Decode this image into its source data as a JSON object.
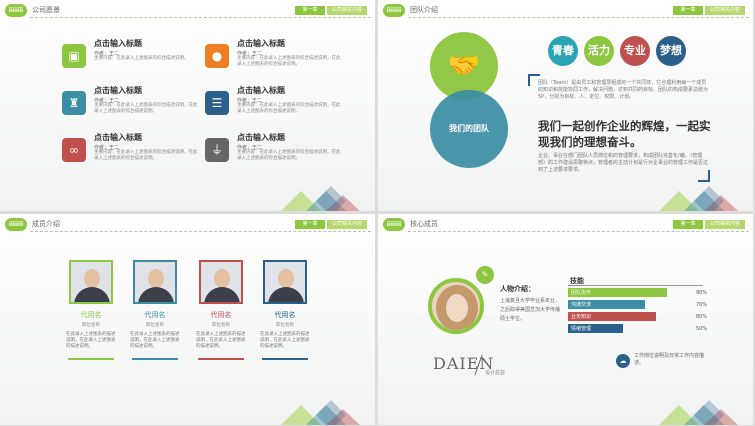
{
  "tags": {
    "chapter": "第一章",
    "company": "公司相关内容"
  },
  "logo": "iiiiiii",
  "slide1": {
    "title": "公司愿景",
    "items": [
      {
        "icon": "presentation-icon",
        "color": "#8dc63f",
        "glyph": "▣",
        "title": "点击输入标题",
        "author": "作者：王二",
        "desc": "主要内容：在此录入上述图表的综合描述说明。"
      },
      {
        "icon": "chat-icon",
        "color": "#ef7d22",
        "glyph": "●",
        "title": "点击输入标题",
        "author": "作者：王二",
        "desc": "主要内容：在此录入上述图表的综合描述说明，在此录入上述图表的综合描述说明。"
      },
      {
        "icon": "trophy-icon",
        "color": "#3b8ea5",
        "glyph": "♜",
        "title": "点击输入标题",
        "author": "作者：王二",
        "desc": "主要内容：在此录入上述图表的综合描述说明，在此录入上述图表的综合描述说明。"
      },
      {
        "icon": "database-icon",
        "color": "#2b5f8c",
        "glyph": "☰",
        "title": "点击输入标题",
        "author": "作者：王二",
        "desc": "主要内容：在此录入上述图表的综合描述说明，在此录入上述图表的综合描述说明。"
      },
      {
        "icon": "link-icon",
        "color": "#c0504d",
        "glyph": "∞",
        "title": "点击输入标题",
        "author": "作者：王二",
        "desc": "主要内容：在此录入上述图表的综合描述说明，在此录入上述图表的综合描述说明。"
      },
      {
        "icon": "plug-icon",
        "color": "#666666",
        "glyph": "⏚",
        "title": "点击输入标题",
        "author": "作者：王二",
        "desc": "主要内容：在此录入上述图表的综合描述说明，在此录入上述图表的综合描述说明。"
      }
    ]
  },
  "slide2": {
    "title": "团队介绍",
    "circle_label": "我们的团队",
    "keywords": [
      {
        "text": "青春",
        "color": "#2aa3b5"
      },
      {
        "text": "活力",
        "color": "#8dc63f"
      },
      {
        "text": "专业",
        "color": "#c0504d"
      },
      {
        "text": "梦想",
        "color": "#2b5f8c"
      }
    ],
    "para1": "团队（Team）是由员工和管理层组成的一个共同体，它合理利用每一个成员的知识和技能协同工作，解决问题，达到共同的目标。团队的构成要素总结为5P，分别为目标、人、定位、权限、计划。",
    "headline": "我们一起创作企业的辉煌，一起实现我们的理想奋斗。",
    "para2": "企业、事业在部门团队人员岗位和的管理要求，构成团队完善化/编，（管理部）的工作建设思路特点，管理者的主动计划是行对企事业的管理工作是否过到了上述要求要求。"
  },
  "slide3": {
    "title": "成员介绍",
    "members": [
      {
        "color": "#8dc63f",
        "name": "代用名",
        "role": "职位名称",
        "desc": "在此录入上述图表的描述说明，在此录入上述图表的描述说明。"
      },
      {
        "color": "#3b8ea5",
        "name": "代用名",
        "role": "职位名称",
        "desc": "在此录入上述图表的描述说明，在此录入上述图表的描述说明。"
      },
      {
        "color": "#c0504d",
        "name": "代用名",
        "role": "职位名称",
        "desc": "在此录入上述图表的描述说明，在此录入上述图表的描述说明。"
      },
      {
        "color": "#2b5f8c",
        "name": "代用名",
        "role": "职位名称",
        "desc": "在此录入上述图表的描述说明，在此录入上述图表的描述说明。"
      }
    ]
  },
  "slide4": {
    "title": "核心成员",
    "person_label": "人物介绍：",
    "person_desc": "上海复旦大学毕业系年业，之后取得美国芝加大学传播硕士学位。",
    "skills_title": "技能",
    "skills": [
      {
        "label": "团队协作",
        "value": 90,
        "pct": "90%",
        "color": "#8dc63f"
      },
      {
        "label": "沟通交流",
        "value": 70,
        "pct": "70%",
        "color": "#3b8ea5"
      },
      {
        "label": "业务知识",
        "value": 80,
        "pct": "80%",
        "color": "#c0504d"
      },
      {
        "label": "情绪管理",
        "value": 50,
        "pct": "50%",
        "color": "#2b5f8c"
      }
    ],
    "brand": "DAIEN",
    "brand_sub": "设计总监",
    "note": "工作岗位说明及日常工作内容描述。"
  }
}
